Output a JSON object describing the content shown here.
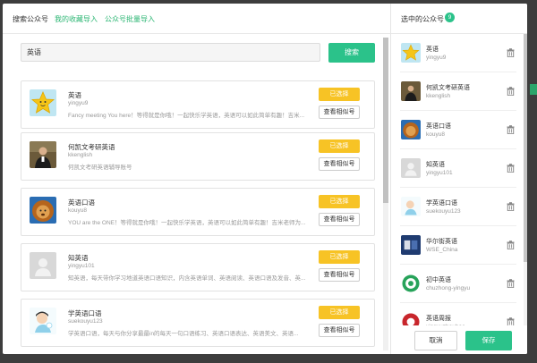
{
  "tabs": [
    {
      "label": "搜索公众号"
    },
    {
      "label": "我的收藏导入"
    },
    {
      "label": "公众号批量导入"
    }
  ],
  "search": {
    "value": "英语",
    "button_label": "搜索"
  },
  "results": [
    {
      "name": "英语",
      "account": "yingyu9",
      "desc": "Fancy meeting You here！等得就是你哦！一起快乐学英语，英语可以如此简单有趣！吉米...",
      "selected_label": "已选择",
      "similar_label": "查看相似号",
      "avatar": "star-icon"
    },
    {
      "name": "何凯文考研英语",
      "account": "kkenglish",
      "desc": "何凯文考研英语辅导账号",
      "selected_label": "已选择",
      "similar_label": "查看相似号",
      "avatar": "person-photo"
    },
    {
      "name": "英语口语",
      "account": "kouyu8",
      "desc": "YOU are the ONE！等得就是你哦！一起快乐学英语，英语可以如此简单有趣！吉米老师为...",
      "selected_label": "已选择",
      "similar_label": "查看相似号",
      "avatar": "lion-photo"
    },
    {
      "name": "知英语",
      "account": "yingyu101",
      "desc": "知英语，每天带你学习地道英语口语知识，内含英语单词、英语阅读、英语口语及发音、英...",
      "selected_label": "已选择",
      "similar_label": "查看相似号",
      "avatar": "default-avatar"
    },
    {
      "name": "学英语口语",
      "account": "suekouyu123",
      "desc": "学英语口语，每天与你分享最最in的每天一句口语练习、英语口语表达、英语美文、英语...",
      "selected_label": "已选择",
      "similar_label": "查看相似号",
      "avatar": "child-illustration"
    }
  ],
  "selected_panel": {
    "title": "选中的公众号",
    "count": "9",
    "items": [
      {
        "name": "英语",
        "account": "yingyu9",
        "avatar": "star-icon"
      },
      {
        "name": "何凯文考研英语",
        "account": "kkenglish",
        "avatar": "person-photo"
      },
      {
        "name": "英语口语",
        "account": "kouyu8",
        "avatar": "lion-photo"
      },
      {
        "name": "知英语",
        "account": "yingyu101",
        "avatar": "default-avatar"
      },
      {
        "name": "学英语口语",
        "account": "suekouyu123",
        "avatar": "child-illustration"
      },
      {
        "name": "华尔街英语",
        "account": "WSE_China",
        "avatar": "wse-logo"
      },
      {
        "name": "初中英语",
        "account": "chuzhong-yingyu",
        "avatar": "green-circle-logo"
      },
      {
        "name": "英语周报",
        "account": "yingyuzhoubao",
        "avatar": "red-circle-logo"
      }
    ],
    "cancel_label": "取消",
    "save_label": "保存"
  },
  "colors": {
    "accent": "#2bc28a",
    "tab_active": "#2bb673",
    "selected": "#f7c325"
  }
}
